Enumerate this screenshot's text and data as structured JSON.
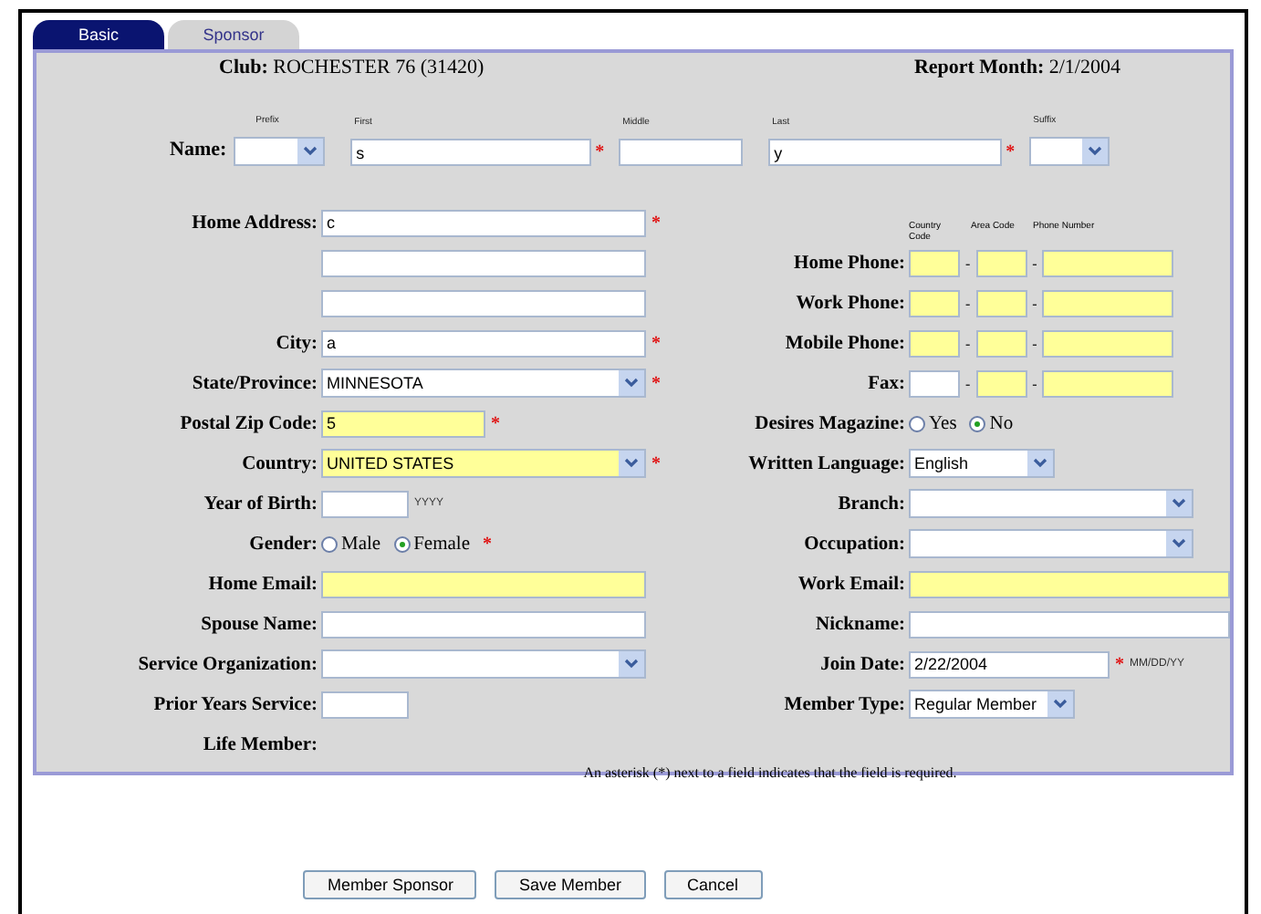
{
  "tabs": [
    {
      "label": "Basic",
      "selected": true
    },
    {
      "label": "Sponsor",
      "selected": false
    }
  ],
  "header": {
    "club_label": "Club:",
    "club_value": "ROCHESTER 76 (31420)",
    "report_label": "Report Month:",
    "report_value": "2/1/2004"
  },
  "name_row": {
    "label": "Name:",
    "parts": [
      {
        "caption": "Prefix",
        "kind": "select"
      },
      {
        "caption": "First",
        "kind": "text",
        "value": "s",
        "asterisk": "*"
      },
      {
        "caption": "Middle",
        "kind": "text"
      },
      {
        "caption": "Last",
        "kind": "text",
        "value": "y",
        "asterisk": "*"
      },
      {
        "caption": "Suffix",
        "kind": "select"
      }
    ]
  },
  "left_fields": [
    {
      "kind": "text",
      "label": "Home Address:",
      "value": "c",
      "asterisk": "*",
      "highlighted": false
    },
    {
      "kind": "text",
      "highlighted": false
    },
    {
      "kind": "text",
      "highlighted": false
    },
    {
      "kind": "text",
      "label": "City:",
      "value": "a",
      "asterisk": "*",
      "highlighted": false
    },
    {
      "kind": "select",
      "label": "State/Province:",
      "value": "MINNESOTA",
      "asterisk": "*",
      "highlighted": false
    },
    {
      "kind": "short_text",
      "label": "Postal Zip Code:",
      "value": "5",
      "asterisk": "*",
      "highlighted": true
    },
    {
      "kind": "select",
      "label": "Country:",
      "value": "UNITED STATES",
      "asterisk": "*",
      "highlighted": true
    },
    {
      "kind": "year",
      "label": "Year of Birth:",
      "hint": "YYYY",
      "highlighted": false
    },
    {
      "kind": "radio",
      "label": "Gender:",
      "asterisk": "*",
      "options": [
        {
          "label": "Male",
          "selected": false
        },
        {
          "label": "Female",
          "selected": true
        }
      ]
    },
    {
      "kind": "text",
      "label": "Home Email:",
      "highlighted": true
    },
    {
      "kind": "text",
      "label": "Spouse Name:",
      "highlighted": false
    },
    {
      "kind": "select",
      "label": "Service Organization:",
      "highlighted": false
    },
    {
      "kind": "year",
      "label": "Prior Years Service:",
      "highlighted": false
    },
    {
      "kind": "label",
      "label": "Life Member:"
    }
  ],
  "right_fields": [
    {
      "kind": "phone_header",
      "captions": [
        "Country Code",
        "Area Code",
        "Phone Number"
      ]
    },
    {
      "kind": "phone",
      "label": "Home Phone:",
      "separators": [
        "-",
        "-"
      ],
      "parts": [
        {
          "highlighted": true
        },
        {
          "highlighted": true
        },
        {
          "highlighted": true
        }
      ]
    },
    {
      "kind": "phone",
      "label": "Work Phone:",
      "separators": [
        "-",
        "-"
      ],
      "parts": [
        {
          "highlighted": true
        },
        {
          "highlighted": true
        },
        {
          "highlighted": true
        }
      ]
    },
    {
      "kind": "phone",
      "label": "Mobile Phone:",
      "separators": [
        "-",
        "-"
      ],
      "parts": [
        {
          "highlighted": true
        },
        {
          "highlighted": true
        },
        {
          "highlighted": true
        }
      ]
    },
    {
      "kind": "phone",
      "label": "Fax:",
      "separators": [
        "-",
        "-"
      ],
      "parts": [
        {
          "highlighted": false
        },
        {
          "highlighted": true
        },
        {
          "highlighted": true
        }
      ]
    },
    {
      "kind": "radio",
      "label": "Desires Magazine:",
      "options": [
        {
          "label": "Yes",
          "selected": false
        },
        {
          "label": "No",
          "selected": true
        }
      ]
    },
    {
      "kind": "short_select",
      "label": "Written Language:",
      "value": "English",
      "highlighted": false
    },
    {
      "kind": "select",
      "label": "Branch:",
      "highlighted": false
    },
    {
      "kind": "select",
      "label": "Occupation:",
      "highlighted": false
    },
    {
      "kind": "text",
      "label": "Work Email:",
      "highlighted": true
    },
    {
      "kind": "text",
      "label": "Nickname:",
      "highlighted": false
    },
    {
      "kind": "date",
      "label": "Join Date:",
      "value": "2/22/2004",
      "hint": "MM/DD/YY",
      "asterisk": "*",
      "highlighted": false
    },
    {
      "kind": "short_select",
      "label": "Member Type:",
      "value": "Regular Member",
      "highlighted": false
    }
  ],
  "footnote": "An asterisk (*) next to a field indicates that the field is required.",
  "buttons": [
    "Member Sponsor",
    "Save Member",
    "Cancel"
  ]
}
